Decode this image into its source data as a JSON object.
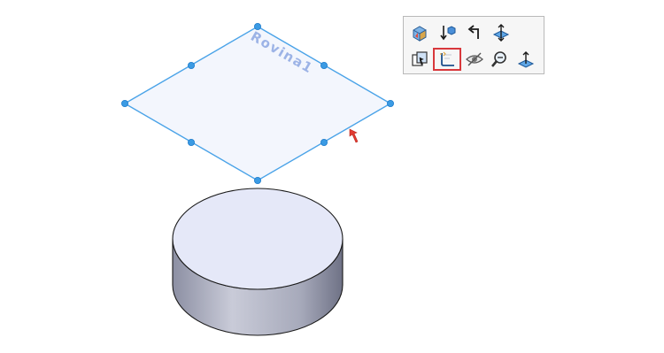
{
  "canvas": {
    "plane_label": "Rovina1",
    "colors": {
      "plane_edge": "#4aa3e8",
      "plane_fill": "#f3f6fd",
      "handle": "#3b9be4",
      "pointer": "#e23c32",
      "cylinder_top": "#e5e8f8",
      "cylinder_side": "#a3a6b8",
      "highlight": "#d8383c"
    }
  },
  "toolbar": {
    "row1": [
      {
        "icon": "view-orientation-icon"
      },
      {
        "icon": "normal-to-icon"
      },
      {
        "icon": "previous-view-icon"
      },
      {
        "icon": "plane-move-icon"
      }
    ],
    "row2": [
      {
        "icon": "copy-entity-icon"
      },
      {
        "icon": "sketch-icon",
        "selected": true
      },
      {
        "icon": "hide-icon"
      },
      {
        "icon": "zoom-to-selection-icon"
      },
      {
        "icon": "normal-plane-icon"
      }
    ]
  }
}
